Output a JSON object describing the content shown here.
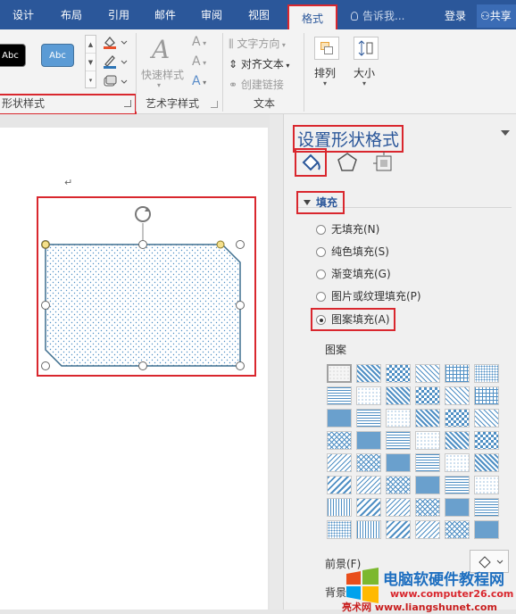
{
  "tabs": [
    {
      "label": "设计"
    },
    {
      "label": "布局"
    },
    {
      "label": "引用"
    },
    {
      "label": "邮件"
    },
    {
      "label": "审阅"
    },
    {
      "label": "视图"
    },
    {
      "label": "格式"
    }
  ],
  "tell_me": "告诉我...",
  "login": "登录",
  "share": "共享",
  "ribbon": {
    "shape_styles": {
      "swatch1": "Abc",
      "swatch2": "Abc",
      "label": "形状样式"
    },
    "wordart": {
      "quick_styles": "快速样式",
      "label": "艺术字样式"
    },
    "text": {
      "text_direction": "文字方向",
      "align_text": "对齐文本",
      "create_link": "创建链接",
      "label": "文本"
    },
    "arrange": "排列",
    "size": "大小"
  },
  "pane": {
    "title": "设置形状格式",
    "fill_header": "填充",
    "options": [
      {
        "label": "无填充(N)"
      },
      {
        "label": "纯色填充(S)"
      },
      {
        "label": "渐变填充(G)"
      },
      {
        "label": "图片或纹理填充(P)"
      },
      {
        "label": "图案填充(A)"
      }
    ],
    "selected_option": "图案填充(A)",
    "pattern_label": "图案",
    "foreground_label": "前景(F)",
    "background_label": "背景"
  },
  "colors": {
    "accent": "#2b579a",
    "highlight": "#d9272e",
    "pattern": "#4f8fc4"
  },
  "watermark": {
    "name": "电脑软硬件教程网",
    "url1": "www.computer26.com",
    "url2": "亮术网 www.liangshunet.com"
  }
}
